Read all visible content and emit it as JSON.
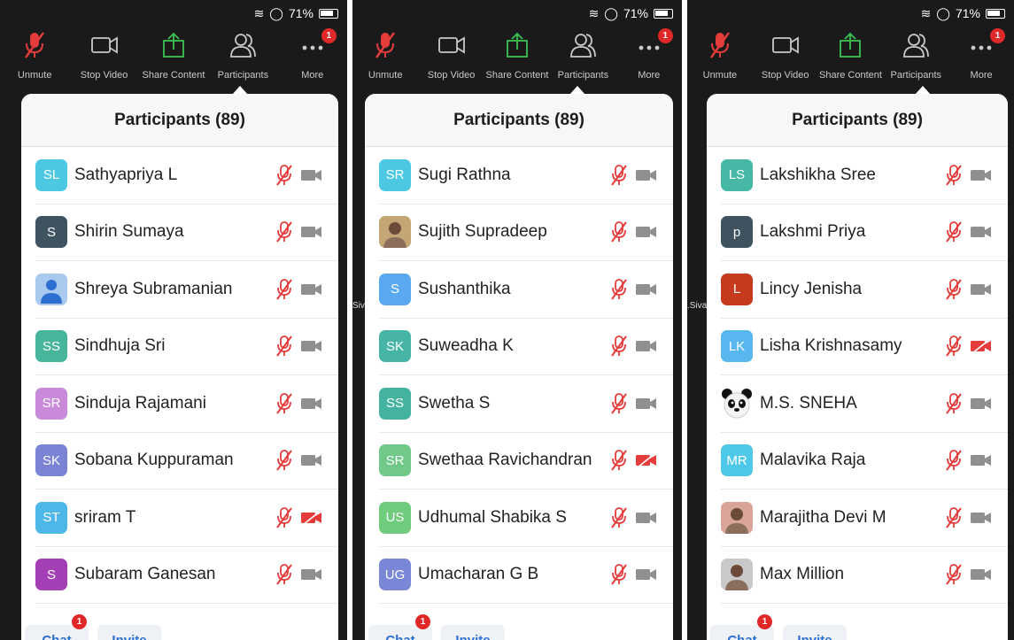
{
  "status": {
    "battery_pct": "71%"
  },
  "toolbar": {
    "items": [
      {
        "label": "Unmute",
        "icon": "muted-mic-icon"
      },
      {
        "label": "Stop Video",
        "icon": "video-camera-icon"
      },
      {
        "label": "Share Content",
        "icon": "share-upload-icon"
      },
      {
        "label": "Participants",
        "icon": "participants-icon"
      },
      {
        "label": "More",
        "icon": "more-dots-icon",
        "badge": "1"
      }
    ]
  },
  "colors": {
    "accent": "#2d6fcf",
    "muted_red": "#e43b3b",
    "badge_red": "#e02828",
    "toolbar_bg": "#1a1a1a"
  },
  "panels": [
    {
      "title": "Participants (89)",
      "edge_text": "",
      "participants": [
        {
          "initials": "SL",
          "name": "Sathyapriya L",
          "color": "#4dc8e3",
          "video_off": false
        },
        {
          "initials": "S",
          "name": "Shirin Sumaya",
          "color": "#3e5260",
          "video_off": false
        },
        {
          "initials": "",
          "name": "Shreya Subramanian",
          "color": "#a9c9ef",
          "photo": "person-silhouette",
          "video_off": false
        },
        {
          "initials": "SS",
          "name": "Sindhuja Sri",
          "color": "#47b59c",
          "video_off": false
        },
        {
          "initials": "SR",
          "name": "Sinduja Rajamani",
          "color": "#c98ad9",
          "video_off": false
        },
        {
          "initials": "SK",
          "name": "Sobana Kuppuraman",
          "color": "#7a83d4",
          "video_off": false
        },
        {
          "initials": "ST",
          "name": "sriram T",
          "color": "#4db7e8",
          "video_off": true
        },
        {
          "initials": "S",
          "name": "Subaram Ganesan",
          "color": "#a43fb5",
          "video_off": false
        }
      ],
      "footer": {
        "chat": "Chat",
        "invite": "Invite",
        "chat_badge": "1"
      }
    },
    {
      "title": "Participants (89)",
      "edge_text": "Siva",
      "participants": [
        {
          "initials": "SR",
          "name": "Sugi Rathna",
          "color": "#4dc8e3",
          "video_off": false
        },
        {
          "initials": "",
          "name": "Sujith Supradeep",
          "color": "#c4a576",
          "photo": "photo",
          "video_off": false
        },
        {
          "initials": "S",
          "name": "Sushanthika",
          "color": "#5aa9f0",
          "video_off": false
        },
        {
          "initials": "SK",
          "name": "Suweadha K",
          "color": "#47b5a6",
          "video_off": false
        },
        {
          "initials": "SS",
          "name": "Swetha S",
          "color": "#43b3a0",
          "video_off": false
        },
        {
          "initials": "SR",
          "name": "Swethaa Ravichandran",
          "color": "#70c889",
          "video_off": true
        },
        {
          "initials": "US",
          "name": "Udhumal Shabika S",
          "color": "#6fcc7c",
          "video_off": false
        },
        {
          "initials": "UG",
          "name": "Umacharan G B",
          "color": "#7987d6",
          "video_off": false
        }
      ],
      "footer": {
        "chat": "Chat",
        "invite": "Invite",
        "chat_badge": "1"
      }
    },
    {
      "title": "Participants (89)",
      "edge_text": ".Siva",
      "participants": [
        {
          "initials": "LS",
          "name": "Lakshikha Sree",
          "color": "#47b8a6",
          "video_off": false
        },
        {
          "initials": "p",
          "name": "Lakshmi Priya",
          "color": "#3e5260",
          "video_off": false
        },
        {
          "initials": "L",
          "name": "Lincy Jenisha",
          "color": "#c63a1d",
          "video_off": false
        },
        {
          "initials": "LK",
          "name": "Lisha Krishnasamy",
          "color": "#59b7f0",
          "video_off": true
        },
        {
          "initials": "",
          "name": "M.S. SNEHA",
          "color": "#ffffff",
          "photo": "panda",
          "video_off": false
        },
        {
          "initials": "MR",
          "name": "Malavika Raja",
          "color": "#4dc8e8",
          "video_off": false
        },
        {
          "initials": "",
          "name": "Marajitha Devi M",
          "color": "#d9a59a",
          "photo": "photo",
          "video_off": false
        },
        {
          "initials": "",
          "name": "Max Million",
          "color": "#c9c9c9",
          "photo": "photo",
          "video_off": false
        }
      ],
      "footer": {
        "chat": "Chat",
        "invite": "Invite",
        "chat_badge": "1"
      }
    }
  ]
}
